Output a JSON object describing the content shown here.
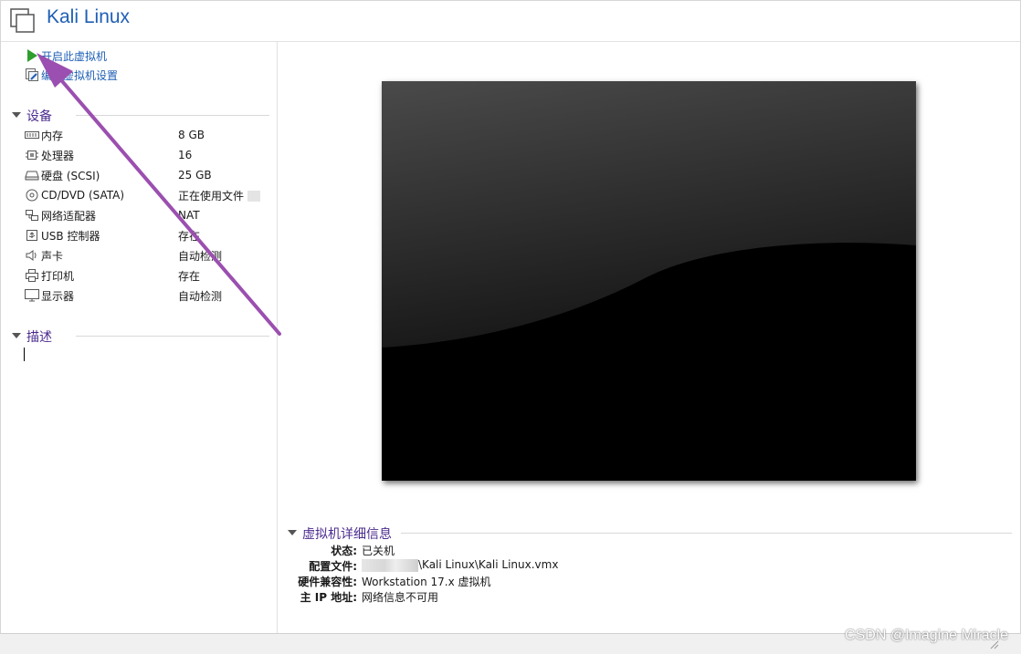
{
  "window": {
    "title": "Kali Linux"
  },
  "actions": [
    {
      "label": "开启此虚拟机",
      "icon": "play-icon"
    },
    {
      "label": "编辑虚拟机设置",
      "icon": "edit-settings-icon"
    }
  ],
  "devices_section": {
    "title": "设备"
  },
  "devices": [
    {
      "name": "内存",
      "value": "8 GB",
      "icon": "memory-icon"
    },
    {
      "name": "处理器",
      "value": "16",
      "icon": "cpu-icon"
    },
    {
      "name": "硬盘 (SCSI)",
      "value": "25 GB",
      "icon": "hard-disk-icon"
    },
    {
      "name": "CD/DVD (SATA)",
      "value": "正在使用文件",
      "icon": "cd-dvd-icon"
    },
    {
      "name": "网络适配器",
      "value": "NAT",
      "icon": "network-adapter-icon"
    },
    {
      "name": "USB 控制器",
      "value": "存在",
      "icon": "usb-icon"
    },
    {
      "name": "声卡",
      "value": "自动检测",
      "icon": "sound-icon"
    },
    {
      "name": "打印机",
      "value": "存在",
      "icon": "printer-icon"
    },
    {
      "name": "显示器",
      "value": "自动检测",
      "icon": "monitor-icon"
    }
  ],
  "description_section": {
    "title": "描述"
  },
  "details": {
    "title": "虚拟机详细信息",
    "rows": [
      {
        "key": "状态:",
        "value": "已关机"
      },
      {
        "key": "配置文件:",
        "value": "\\Kali Linux\\Kali Linux.vmx"
      },
      {
        "key": "硬件兼容性:",
        "value": "Workstation 17.x 虚拟机"
      },
      {
        "key": "主 IP 地址:",
        "value": "网络信息不可用"
      }
    ]
  },
  "watermark": "CSDN @Imagine Miracle",
  "colors": {
    "title": "#1f5fb5",
    "section": "#4b2b8f",
    "arrow": "#9b4fb0",
    "play": "#2e9e2e"
  }
}
